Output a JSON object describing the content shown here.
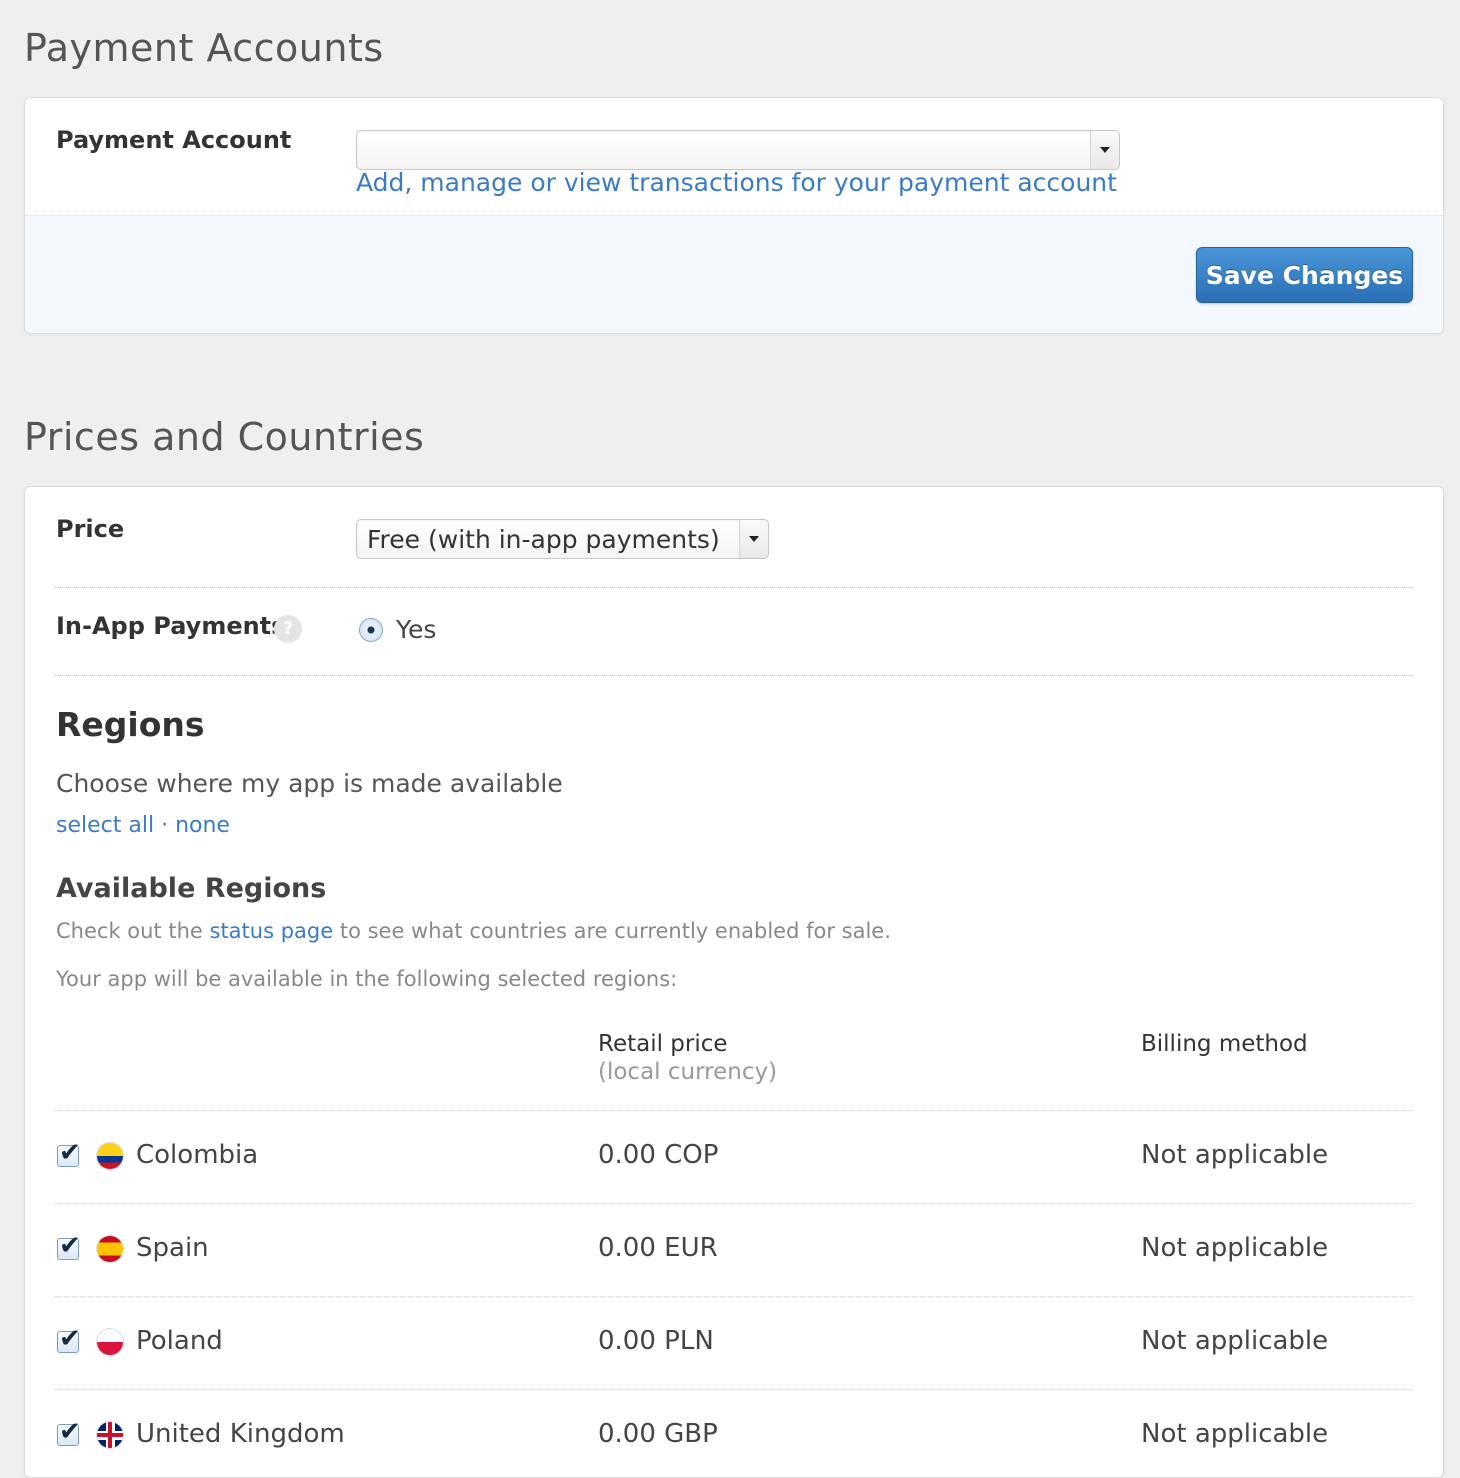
{
  "payment_section": {
    "title": "Payment Accounts",
    "account_label": "Payment Account",
    "account_value": "",
    "manage_link": "Add, manage or view transactions for your payment account",
    "save_label": "Save Changes"
  },
  "prices_section": {
    "title": "Prices and Countries",
    "price_label": "Price",
    "price_value": "Free (with in-app payments)",
    "inapp_label": "In-App Payments",
    "help_glyph": "?",
    "inapp_option": "Yes",
    "regions_title": "Regions",
    "regions_subtitle": "Choose where my app is made available",
    "select_all": "select all",
    "separator": "·",
    "select_none": "none",
    "available_title": "Available Regions",
    "status_pre": "Check out the",
    "status_link": "status page",
    "status_post": "to see what countries are currently enabled for sale.",
    "selected_note": "Your app will be available in the following selected regions:",
    "col_price": "Retail price",
    "col_price_sub": "(local currency)",
    "col_billing": "Billing method",
    "regions": [
      {
        "country": "Colombia",
        "price": "0.00 COP",
        "billing": "Not applicable",
        "flag": "colombia-flag-icon"
      },
      {
        "country": "Spain",
        "price": "0.00 EUR",
        "billing": "Not applicable",
        "flag": "spain-flag-icon"
      },
      {
        "country": "Poland",
        "price": "0.00 PLN",
        "billing": "Not applicable",
        "flag": "poland-flag-icon"
      },
      {
        "country": "United Kingdom",
        "price": "0.00 GBP",
        "billing": "Not applicable",
        "flag": "uk-flag-icon"
      }
    ]
  },
  "colors": {
    "link": "#3a7bc8",
    "button": "#2b6fb5",
    "background": "#efefef"
  }
}
